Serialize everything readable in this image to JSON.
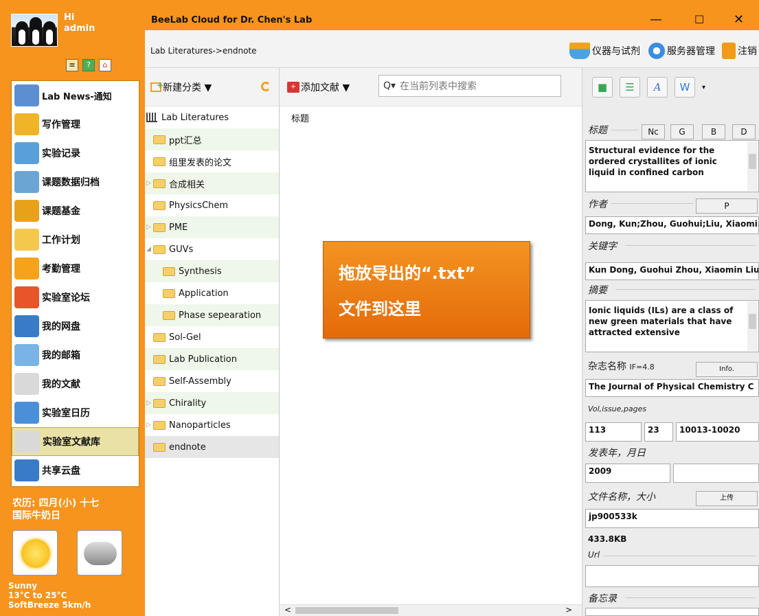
{
  "window": {
    "title": "BeeLab Cloud for Dr. Chen's Lab",
    "minimize": "—",
    "maximize": "☐",
    "close": "✕"
  },
  "user": {
    "hi": "Hi",
    "name": "admin"
  },
  "nav": [
    {
      "label": "Lab News-通知",
      "icon": "news-icon",
      "color": "#5b8fd1"
    },
    {
      "label": "写作管理",
      "icon": "pencil-icon",
      "color": "#f0b429"
    },
    {
      "label": "实验记录",
      "icon": "notebook-icon",
      "color": "#5aa0d8"
    },
    {
      "label": "课题数据归档",
      "icon": "archive-icon",
      "color": "#6aa5d4"
    },
    {
      "label": "课题基金",
      "icon": "coins-icon",
      "color": "#e8a11a"
    },
    {
      "label": "工作计划",
      "icon": "calendar-plan-icon",
      "color": "#f2c94c"
    },
    {
      "label": "考勤管理",
      "icon": "clock-icon",
      "color": "#f7a21b"
    },
    {
      "label": "实验室论坛",
      "icon": "forum-icon",
      "color": "#e8552b"
    },
    {
      "label": "我的网盘",
      "icon": "cloud-drive-icon",
      "color": "#3a7bc8"
    },
    {
      "label": "我的邮箱",
      "icon": "mail-icon",
      "color": "#7ab4e6"
    },
    {
      "label": "我的文献",
      "icon": "pdf-icon",
      "color": "#d9d9d9"
    },
    {
      "label": "实验室日历",
      "icon": "calendar-icon",
      "color": "#4a90d9"
    },
    {
      "label": "实验室文献库",
      "icon": "pdf-library-icon",
      "color": "#d9d9d9",
      "active": true
    },
    {
      "label": "共享云盘",
      "icon": "shared-drive-icon",
      "color": "#3a7bc8"
    }
  ],
  "lunar": {
    "date": "农历: 四月(小) 十七",
    "festival": "国际牛奶日"
  },
  "weather": {
    "condition": "Sunny",
    "temp": "13°C  to  25°C",
    "wind": "SoftBreeze  5km/h"
  },
  "breadcrumb": "Lab Literatures->endnote",
  "toptools": {
    "instruments": "仪器与试剂",
    "server": "服务器管理",
    "logout": "注销"
  },
  "tree": {
    "new_category": "新建分类 ▼",
    "items": [
      {
        "label": "Lab Literatures",
        "depth": 0,
        "toggle": "",
        "root": true
      },
      {
        "label": "ppt汇总",
        "depth": 1,
        "toggle": ""
      },
      {
        "label": "组里发表的论文",
        "depth": 1,
        "toggle": ""
      },
      {
        "label": "合成相关",
        "depth": 1,
        "toggle": "▷"
      },
      {
        "label": "PhysicsChem",
        "depth": 1,
        "toggle": ""
      },
      {
        "label": "PME",
        "depth": 1,
        "toggle": "▷"
      },
      {
        "label": "GUVs",
        "depth": 1,
        "toggle": "◢"
      },
      {
        "label": "Synthesis",
        "depth": 2,
        "toggle": ""
      },
      {
        "label": "Application",
        "depth": 2,
        "toggle": ""
      },
      {
        "label": "Phase sepearation",
        "depth": 2,
        "toggle": ""
      },
      {
        "label": "Sol-Gel",
        "depth": 1,
        "toggle": ""
      },
      {
        "label": "Lab Publication",
        "depth": 1,
        "toggle": ""
      },
      {
        "label": "Self-Assembly",
        "depth": 1,
        "toggle": ""
      },
      {
        "label": "Chirality",
        "depth": 1,
        "toggle": "▷"
      },
      {
        "label": "Nanoparticles",
        "depth": 1,
        "toggle": "▷"
      },
      {
        "label": "endnote",
        "depth": 1,
        "toggle": "",
        "selected": true
      }
    ]
  },
  "list": {
    "add": "添加文献 ▼",
    "search_placeholder": "在当前列表中搜索",
    "column_title": "标题",
    "drop_line1": "拖放导出的“.txt”",
    "drop_line2": "文件到这里",
    "scroll_left": "<",
    "scroll_right": ">"
  },
  "detail": {
    "title_label": "标题",
    "title_buttons": [
      "Nc",
      "G",
      "B",
      "D"
    ],
    "title_value": "Structural evidence for the ordered crystallites of ionic liquid in confined carbon",
    "author_label": "作者",
    "author_button": "P",
    "author_value": "Dong, Kun;Zhou, Guohui;Liu, Xiaomin",
    "keyword_label": "关键字",
    "keyword_value": "Kun Dong, Guohui Zhou, Xiaomin Liu",
    "abstract_label": "摘要",
    "abstract_value": "Ionic liquids (ILs) are a class of new green materials that have attracted extensive",
    "journal_label": "杂志名称",
    "impact_factor": "IF=4.8",
    "journal_button": "Info.",
    "journal_value": "The Journal of Physical Chemistry C",
    "vip_label": "Vol,issue,pages",
    "volume": "113",
    "issue": "23",
    "pages": "10013-10020",
    "date_label": "发表年，月日",
    "year": "2009",
    "month_day": "",
    "file_label": "文件名称，大小",
    "upload_button": "上传",
    "file_name": "jp900533k",
    "file_size": "433.8KB",
    "url_label": "Url",
    "url_value": "",
    "memo_label": "备忘录"
  }
}
